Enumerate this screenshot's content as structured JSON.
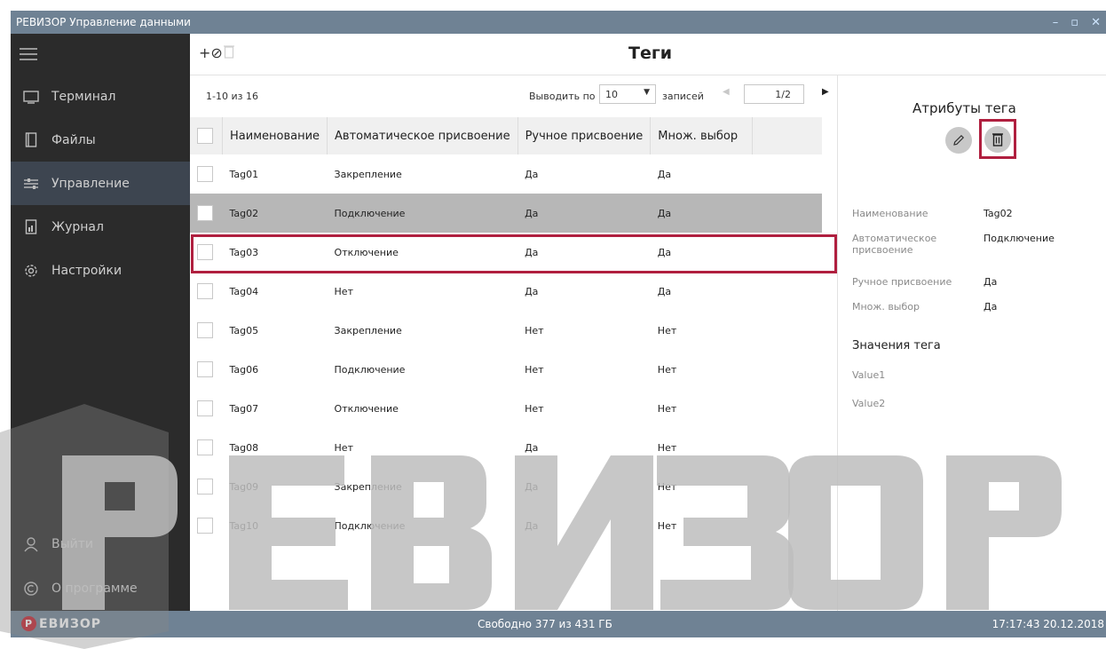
{
  "window": {
    "title": "РЕВИЗОР Управление данными"
  },
  "sidebar": {
    "items": [
      {
        "label": "Терминал",
        "icon": "terminal-icon"
      },
      {
        "label": "Файлы",
        "icon": "files-icon"
      },
      {
        "label": "Управление",
        "icon": "sliders-icon",
        "active": true
      },
      {
        "label": "Журнал",
        "icon": "journal-icon"
      },
      {
        "label": "Настройки",
        "icon": "gear-icon"
      }
    ],
    "bottom": [
      {
        "label": "Выйти",
        "icon": "user-icon"
      },
      {
        "label": "О программе",
        "icon": "copyright-icon"
      }
    ]
  },
  "toolbar": {
    "title": "Теги",
    "add_label": "+⊘"
  },
  "pager": {
    "count": "1-10 из 16",
    "per_page_label": "Выводить по",
    "per_page_value": "10",
    "records_label": "записей",
    "page": "1/2"
  },
  "table": {
    "columns": [
      "Наименование",
      "Автоматическое присвоение",
      "Ручное присвоение",
      "Множ. выбор"
    ],
    "rows": [
      [
        "Tag01",
        "Закрепление",
        "Да",
        "Да"
      ],
      [
        "Tag02",
        "Подключение",
        "Да",
        "Да"
      ],
      [
        "Tag03",
        "Отключение",
        "Да",
        "Да"
      ],
      [
        "Tag04",
        "Нет",
        "Да",
        "Да"
      ],
      [
        "Tag05",
        "Закрепление",
        "Нет",
        "Нет"
      ],
      [
        "Tag06",
        "Подключение",
        "Нет",
        "Нет"
      ],
      [
        "Tag07",
        "Отключение",
        "Нет",
        "Нет"
      ],
      [
        "Tag08",
        "Нет",
        "Да",
        "Нет"
      ],
      [
        "Tag09",
        "Закрепление",
        "Да",
        "Нет"
      ],
      [
        "Tag10",
        "Подключение",
        "Да",
        "Нет"
      ]
    ],
    "selected_row": 1
  },
  "attributes": {
    "title": "Атрибуты тега",
    "fields": [
      {
        "label": "Наименование",
        "value": "Tag02"
      },
      {
        "label": "Автоматическое присвоение",
        "value": "Подключение"
      },
      {
        "label": "Ручное присвоение",
        "value": "Да"
      },
      {
        "label": "Множ. выбор",
        "value": "Да"
      }
    ],
    "values_title": "Значения тега",
    "values": [
      "Value1",
      "Value2"
    ]
  },
  "statusbar": {
    "logo": "ЕВИЗОР",
    "logo_letter": "Р",
    "free_space": "Свободно 377 из 431 ГБ",
    "clock": "17:17:43 20.12.2018"
  },
  "watermark": {
    "text": "РЕВИЗОР"
  },
  "colors": {
    "accent": "#b01f3f",
    "chrome": "#6f8294",
    "sidebar": "#2b2b2b",
    "selected_row": "#b7b7b7"
  }
}
